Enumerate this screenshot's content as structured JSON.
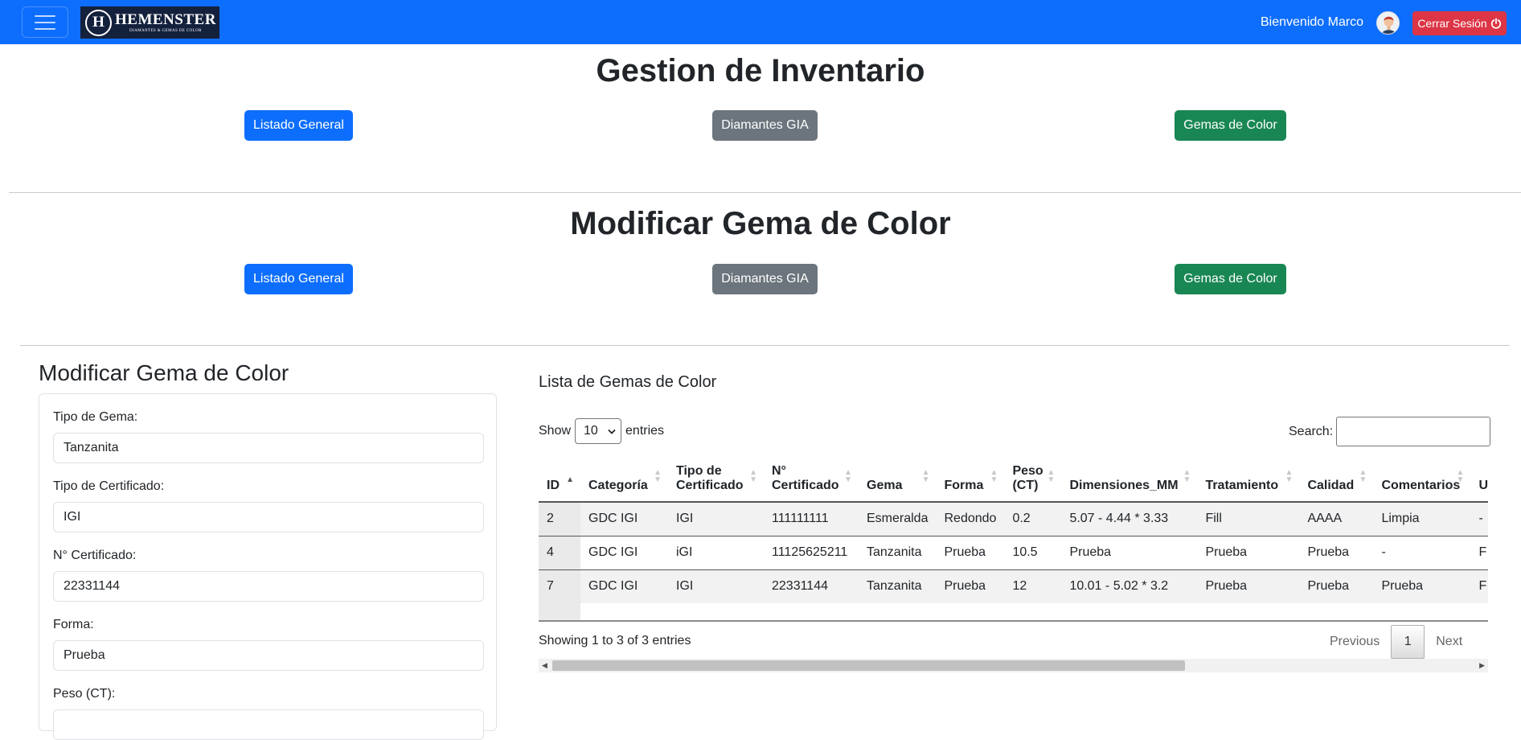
{
  "navbar": {
    "brand_initial": "H",
    "brand_name": "HEMENSTER",
    "brand_tagline": "DIAMANTES & GEMAS DE COLOR",
    "welcome": "Bienvenido Marco",
    "logout_label": "Cerrar Sesión",
    "colors": {
      "bar": "#0d6efd",
      "logout": "#dc3545",
      "logo_bg": "#14213d"
    }
  },
  "section1": {
    "title": "Gestion de Inventario",
    "buttons": [
      "Listado General",
      "Diamantes GIA",
      "Gemas de Color"
    ]
  },
  "section2": {
    "title": "Modificar Gema de Color",
    "buttons": [
      "Listado General",
      "Diamantes GIA",
      "Gemas de Color"
    ]
  },
  "form": {
    "title": "Modificar Gema de Color",
    "fields": [
      {
        "label": "Tipo de Gema:",
        "value": "Tanzanita"
      },
      {
        "label": "Tipo de Certificado:",
        "value": "IGI"
      },
      {
        "label": "N° Certificado:",
        "value": "22331144"
      },
      {
        "label": "Forma:",
        "value": "Prueba"
      },
      {
        "label": "Peso (CT):",
        "value": ""
      }
    ]
  },
  "table": {
    "title": "Lista de Gemas de Color",
    "show_label": "Show",
    "entries_value": "10",
    "entries_label": "entries",
    "search_label": "Search:",
    "columns": [
      "ID",
      "Categoría",
      "Tipo de Certificado",
      "N° Certificado",
      "Gema",
      "Forma",
      "Peso (CT)",
      "Dimensiones_MM",
      "Tratamiento",
      "Calidad",
      "Comentarios",
      "U"
    ],
    "column_lines": [
      [
        "ID"
      ],
      [
        "Categoría"
      ],
      [
        "Tipo de",
        "Certificado"
      ],
      [
        "N°",
        "Certificado"
      ],
      [
        "Gema"
      ],
      [
        "Forma"
      ],
      [
        "Peso",
        "(CT)"
      ],
      [
        "Dimensiones_MM"
      ],
      [
        "Tratamiento"
      ],
      [
        "Calidad"
      ],
      [
        "Comentarios"
      ],
      [
        "U"
      ]
    ],
    "rows": [
      [
        "2",
        "GDC IGI",
        "IGI",
        "111111111",
        "Esmeralda",
        "Redondo",
        "0.2",
        "5.07 - 4.44 * 3.33",
        "Fill",
        "AAAA",
        "Limpia",
        "-"
      ],
      [
        "4",
        "GDC IGI",
        "iGI",
        "11125625211",
        "Tanzanita",
        "Prueba",
        "10.5",
        "Prueba",
        "Prueba",
        "Prueba",
        "-",
        "F"
      ],
      [
        "7",
        "GDC IGI",
        "IGI",
        "22331144",
        "Tanzanita",
        "Prueba",
        "12",
        "10.01 - 5.02 * 3.2",
        "Prueba",
        "Prueba",
        "Prueba",
        "F"
      ]
    ],
    "info": "Showing 1 to 3 of 3 entries",
    "previous": "Previous",
    "current_page": "1",
    "next": "Next"
  }
}
